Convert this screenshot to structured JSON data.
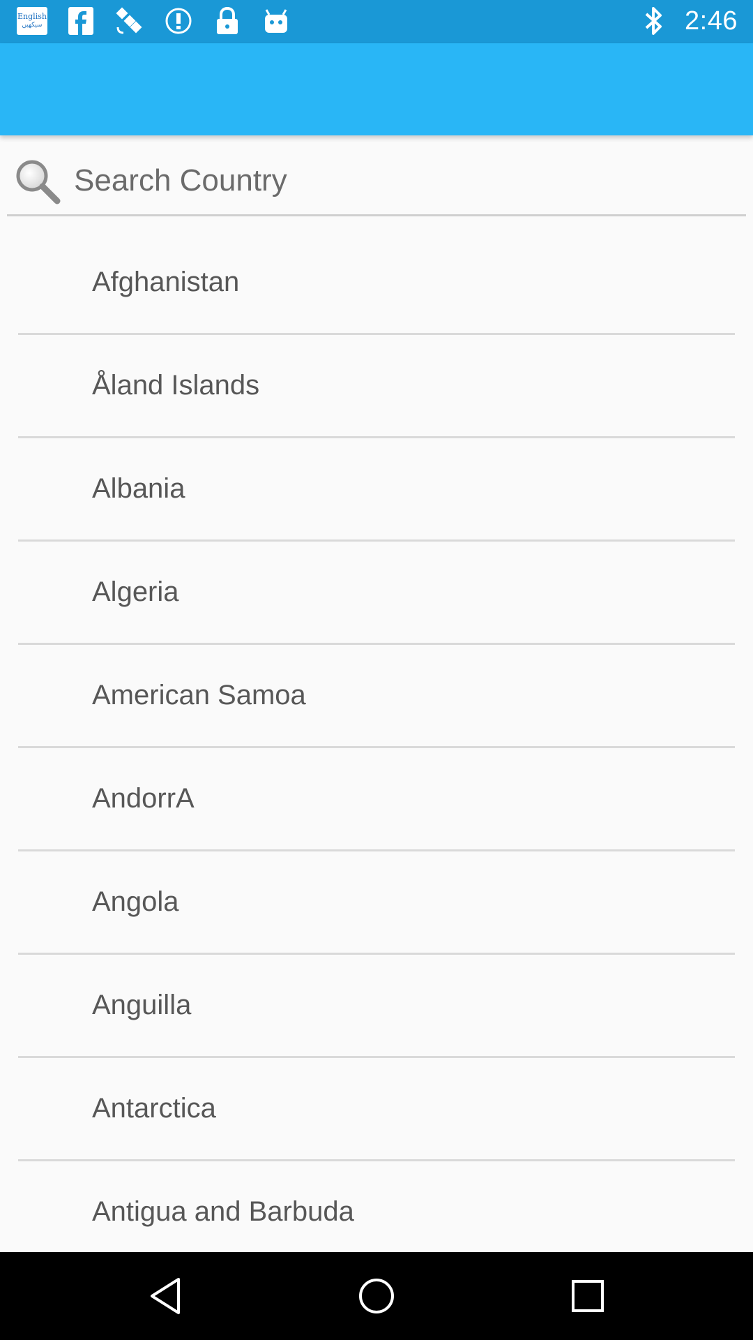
{
  "status_bar": {
    "time": "2:46",
    "language_badge_top": "English",
    "language_badge_bottom": "سیکھیں",
    "left_icons": [
      "language-badge-icon",
      "facebook-icon",
      "satellite-icon",
      "alert-circle-icon",
      "lock-icon",
      "android-icon"
    ],
    "right_icons": [
      "bluetooth-icon"
    ],
    "background_color": "#1a98d6"
  },
  "app_bar": {
    "title": "",
    "color": "#29b6f6"
  },
  "search": {
    "placeholder": "Search Country",
    "value": ""
  },
  "countries": [
    {
      "name": "Afghanistan"
    },
    {
      "name": "Åland Islands"
    },
    {
      "name": "Albania"
    },
    {
      "name": "Algeria"
    },
    {
      "name": "American Samoa"
    },
    {
      "name": "AndorrA"
    },
    {
      "name": "Angola"
    },
    {
      "name": "Anguilla"
    },
    {
      "name": "Antarctica"
    },
    {
      "name": "Antigua and Barbuda"
    }
  ],
  "nav_bar": {
    "buttons": [
      "back-icon",
      "home-icon",
      "recents-icon"
    ]
  }
}
